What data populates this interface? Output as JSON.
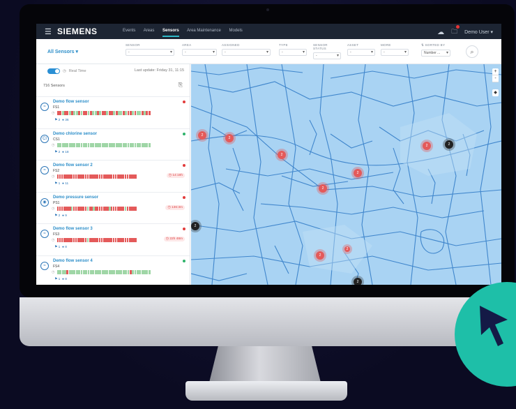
{
  "app": {
    "brand": "SIEMENS",
    "nav": [
      {
        "label": "Events",
        "active": false
      },
      {
        "label": "Areas",
        "active": false
      },
      {
        "label": "Sensors",
        "active": true
      },
      {
        "label": "Area Maintenance",
        "active": false
      },
      {
        "label": "Models",
        "active": false
      }
    ],
    "user": "Demo User",
    "icons": {
      "cloud": "cloud-icon",
      "notification": "bell-icon",
      "menu": "hamburger-icon"
    }
  },
  "filters": {
    "title": "All Sensors",
    "items": [
      {
        "label": "SENSOR",
        "value": "-"
      },
      {
        "label": "AREA",
        "value": "-"
      },
      {
        "label": "ASSIGNED",
        "value": "-"
      },
      {
        "label": "TYPE",
        "value": "-"
      },
      {
        "label": "SENSOR STATUS",
        "value": "-"
      },
      {
        "label": "ASSET",
        "value": "-"
      },
      {
        "label": "MORE",
        "value": "-"
      },
      {
        "label": "SORTED BY",
        "value": "Number ..."
      }
    ]
  },
  "sidebar": {
    "realtime_label": "Real Time",
    "last_update": "Last update: Friday 31, 11:15",
    "count": "716 Sensors",
    "sensors": [
      {
        "name": "Demo flow sensor",
        "code": "FS1",
        "status": "#e23b3b",
        "pct_red": 0.55,
        "duration": "",
        "stat_a": "2",
        "stat_b": "36"
      },
      {
        "name": "Demo chlorine sensor",
        "code": "CS1",
        "status": "#2fb36a",
        "pct_red": 0.0,
        "duration": "",
        "stat_a": "2",
        "stat_b": "18"
      },
      {
        "name": "Demo flow sensor 2",
        "code": "FS2",
        "status": "#e23b3b",
        "pct_red": 1.0,
        "duration": "14:19h",
        "stat_a": "1",
        "stat_b": "11"
      },
      {
        "name": "Demo pressure sensor",
        "code": "PS1",
        "status": "#e23b3b",
        "pct_red": 0.85,
        "duration": "136:3m",
        "stat_a": "2",
        "stat_b": "9"
      },
      {
        "name": "Demo flow sensor 3",
        "code": "FS3",
        "status": "#e23b3b",
        "pct_red": 0.97,
        "duration": "22h 48m",
        "stat_a": "1",
        "stat_b": "8"
      },
      {
        "name": "Demo flow sensor 4",
        "code": "FS4",
        "status": "#2fb36a",
        "pct_red": 0.06,
        "duration": "",
        "stat_a": "1",
        "stat_b": "8"
      }
    ]
  },
  "map": {
    "zoom_in": "+",
    "zoom_out": "-",
    "clusters": [
      {
        "label": "2",
        "color": "red"
      },
      {
        "label": "2",
        "color": "red"
      },
      {
        "label": "2",
        "color": "red"
      },
      {
        "label": "2",
        "color": "red"
      },
      {
        "label": "2",
        "color": "red"
      },
      {
        "label": "2",
        "color": "red"
      },
      {
        "label": "2",
        "color": "red"
      },
      {
        "label": "2",
        "color": "red"
      },
      {
        "label": "2",
        "color": "dark"
      },
      {
        "label": "2",
        "color": "dark"
      },
      {
        "label": "2",
        "color": "dark"
      }
    ]
  },
  "colors": {
    "accent": "#2c8ec9",
    "topbar": "#1d2533",
    "map": "#a9d3f3",
    "alarm": "#e45a5a",
    "ok": "#2fb36a",
    "badge": "#1ebfa8"
  }
}
